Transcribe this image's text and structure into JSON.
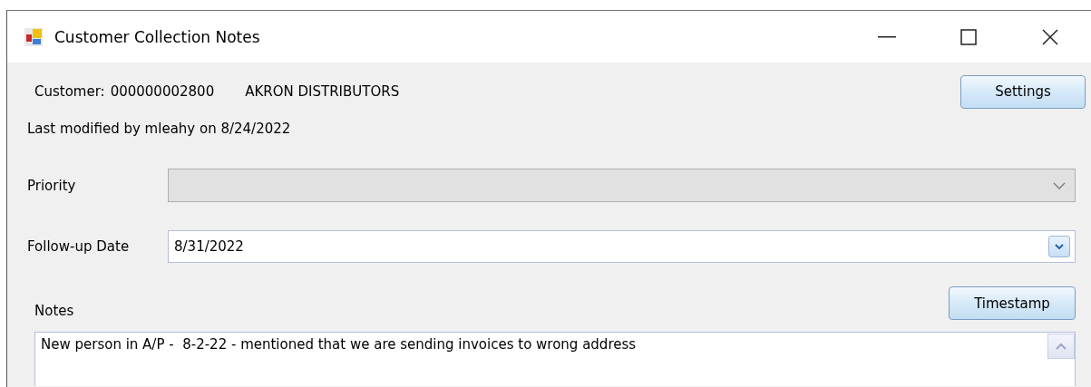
{
  "window": {
    "title": "Customer Collection Notes"
  },
  "customer": {
    "label": "Customer:",
    "number": "000000002800",
    "name": "AKRON DISTRIBUTORS"
  },
  "settings_button": "Settings",
  "last_modified": "Last modified by mleahy on 8/24/2022",
  "priority": {
    "label": "Priority",
    "disabled": true
  },
  "follow_up": {
    "label": "Follow-up Date",
    "value": "8/31/2022"
  },
  "notes": {
    "label": "Notes",
    "value": "New person in A/P -  8-2-22 - mentioned that we are sending invoices to wrong address"
  },
  "timestamp_button": "Timestamp"
}
